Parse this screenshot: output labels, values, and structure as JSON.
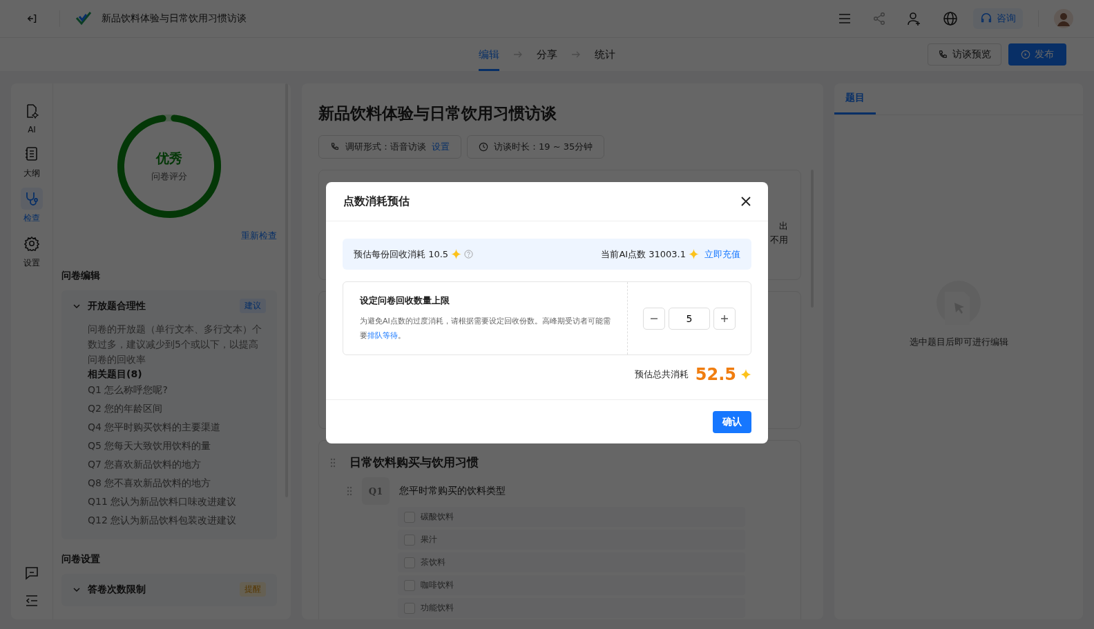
{
  "header": {
    "title": "新品饮料体验与日常饮用习惯访谈",
    "consult": "咨询"
  },
  "steps": [
    {
      "label": "编辑",
      "selected": true
    },
    {
      "label": "分享",
      "selected": false
    },
    {
      "label": "统计",
      "selected": false
    }
  ],
  "actions": {
    "preview": "访谈预览",
    "publish": "发布"
  },
  "rail": [
    {
      "label": "AI",
      "selected": false
    },
    {
      "label": "大纲",
      "selected": false
    },
    {
      "label": "检查",
      "selected": true
    },
    {
      "label": "设置",
      "selected": false
    }
  ],
  "score": {
    "grade": "优秀",
    "caption": "问卷评分",
    "level": 0.96,
    "recheck": "重新检查"
  },
  "sections": [
    {
      "title": "问卷编辑",
      "issues": [
        {
          "title": "开放题合理性",
          "tag": "建议",
          "expanded": true,
          "description": "问卷的开放题（单行文本、多行文本）个数过多，建议减少到5个或以下，以提高问卷的回收率",
          "related_title": "相关题目(8)",
          "related": [
            "Q1 怎么称呼您呢?",
            "Q2 您的年龄区间",
            "Q4 您平时购买饮料的主要渠道",
            "Q5 您每天大致饮用饮料的量",
            "Q7 您喜欢新品饮料的地方",
            "Q8 您不喜欢新品饮料的地方",
            "Q11 您认为新品饮料口味改进建议",
            "Q12 您认为新品饮料包装改进建议"
          ]
        }
      ]
    },
    {
      "title": "问卷设置",
      "issues": [
        {
          "title": "答卷次数限制",
          "tag": "提醒",
          "expanded": true
        }
      ]
    }
  ],
  "survey": {
    "title": "新品饮料体验与日常饮用习惯访谈",
    "chips": [
      {
        "label": "调研形式：语音访谈",
        "link": "设置"
      },
      {
        "label": "访谈时长：19 ~ 35分钟"
      }
    ],
    "fragments": [
      "出",
      "不用"
    ],
    "section_title": "日常饮料购买与饮用习惯",
    "question": {
      "number": "Q1",
      "text": "您平时常购买的饮料类型",
      "options": [
        {
          "label": "碳酸饮料",
          "checked": false
        },
        {
          "label": "果汁",
          "checked": false
        },
        {
          "label": "茶饮料",
          "checked": false
        },
        {
          "label": "咖啡饮料",
          "checked": false
        },
        {
          "label": "功能饮料",
          "checked": false
        }
      ]
    }
  },
  "right_panel": {
    "tabs": [
      {
        "label": "题目",
        "selected": true
      }
    ],
    "empty_text": "选中题目后即可进行编辑"
  },
  "modal": {
    "title": "点数消耗预估",
    "per_cost": "预估每份回收消耗 10.5",
    "balance": "当前AI点数 31003.1",
    "recharge": "立即充值",
    "limit_title": "设定问卷回收数量上限",
    "limit_desc": "为避免AI点数的过度消耗，请根据需要设定回收份数。高峰期受访者可能需要",
    "limit_link": "排队等待",
    "limit_end": "。",
    "value": "5",
    "total_label": "预估总共消耗",
    "total_value": "52.5",
    "confirm": "确认"
  }
}
